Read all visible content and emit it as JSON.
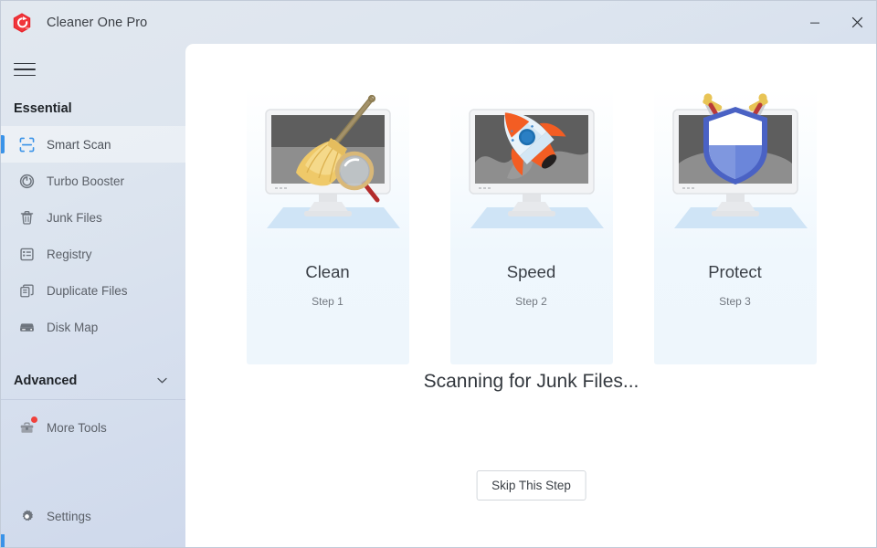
{
  "window": {
    "title": "Cleaner One Pro",
    "logo_icon": "cleaner-one-hexagon-logo",
    "controls": [
      {
        "name": "minimize-button",
        "icon": "minimize-icon",
        "label": "–"
      },
      {
        "name": "close-button",
        "icon": "close-icon",
        "label": "×"
      }
    ]
  },
  "sidebar": {
    "menu_icon": "hamburger-menu-icon",
    "sections": [
      {
        "label": "Essential"
      },
      {
        "label": "Advanced",
        "chevron_icon": "chevron-down-icon"
      }
    ],
    "essential_items": [
      {
        "label": "Smart Scan",
        "icon": "smart-scan-icon",
        "active": true
      },
      {
        "label": "Turbo Booster",
        "icon": "power-booster-icon",
        "active": false
      },
      {
        "label": "Junk Files",
        "icon": "trash-can-icon",
        "active": false
      },
      {
        "label": "Registry",
        "icon": "registry-list-icon",
        "active": false
      },
      {
        "label": "Duplicate Files",
        "icon": "duplicate-files-icon",
        "active": false
      },
      {
        "label": "Disk Map",
        "icon": "disk-drive-icon",
        "active": false
      }
    ],
    "advanced_items": [
      {
        "label": "More Tools",
        "icon": "toolbox-icon",
        "badge": true
      }
    ],
    "footer": {
      "label": "Settings",
      "icon": "gear-icon"
    },
    "accent_color": "#3a93e8"
  },
  "main": {
    "cards": [
      {
        "title": "Clean",
        "step": "Step 1",
        "art": "monitor-broom-magnifier"
      },
      {
        "title": "Speed",
        "step": "Step 2",
        "art": "monitor-rocket"
      },
      {
        "title": "Protect",
        "step": "Step 3",
        "art": "monitor-shield-swords"
      }
    ],
    "status": "Scanning for Junk Files...",
    "skip_button": "Skip This Step"
  }
}
